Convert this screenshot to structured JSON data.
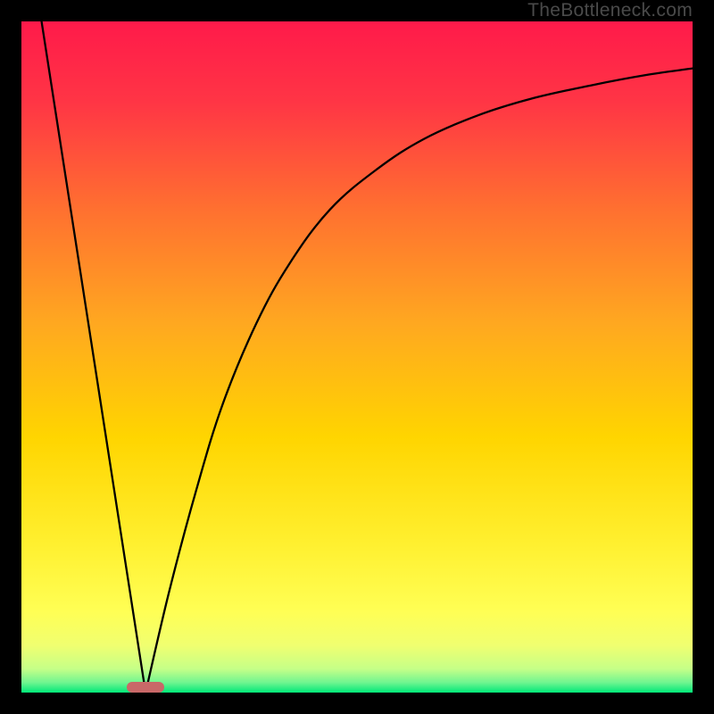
{
  "watermark": "TheBottleneck.com",
  "chart_data": {
    "type": "line",
    "title": "",
    "xlabel": "",
    "ylabel": "",
    "xlim": [
      0,
      100
    ],
    "ylim": [
      0,
      100
    ],
    "gradient_colors": {
      "top": "#ff1a4a",
      "upper_mid": "#ff8030",
      "mid": "#ffd500",
      "lower_mid": "#ffff55",
      "near_bottom": "#e5ff7a",
      "bottom": "#00e878"
    },
    "series": [
      {
        "name": "left-line",
        "type": "line",
        "points": [
          {
            "x": 3,
            "y": 100
          },
          {
            "x": 18.5,
            "y": 0
          }
        ]
      },
      {
        "name": "right-curve",
        "type": "curve",
        "points": [
          {
            "x": 18.5,
            "y": 0
          },
          {
            "x": 22,
            "y": 15
          },
          {
            "x": 26,
            "y": 30
          },
          {
            "x": 30,
            "y": 43
          },
          {
            "x": 35,
            "y": 55
          },
          {
            "x": 40,
            "y": 64
          },
          {
            "x": 46,
            "y": 72
          },
          {
            "x": 53,
            "y": 78
          },
          {
            "x": 60,
            "y": 82.5
          },
          {
            "x": 68,
            "y": 86
          },
          {
            "x": 76,
            "y": 88.5
          },
          {
            "x": 85,
            "y": 90.5
          },
          {
            "x": 93,
            "y": 92
          },
          {
            "x": 100,
            "y": 93
          }
        ]
      }
    ],
    "marker": {
      "x": 18.5,
      "color": "#c96868"
    },
    "curve_color": "#000000",
    "curve_width": 2.3
  }
}
